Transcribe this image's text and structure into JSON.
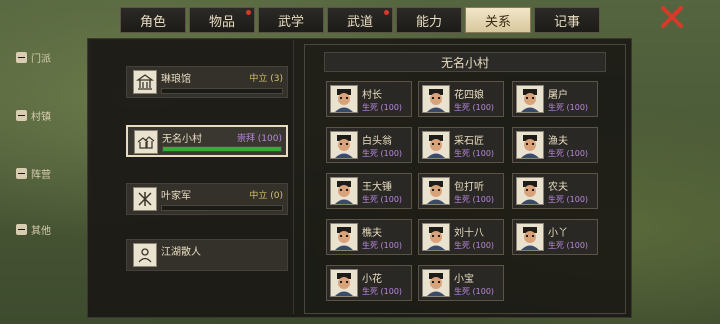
{
  "tabs": [
    {
      "label": "角色",
      "dot": false,
      "active": false
    },
    {
      "label": "物品",
      "dot": true,
      "active": false
    },
    {
      "label": "武学",
      "dot": false,
      "active": false
    },
    {
      "label": "武道",
      "dot": true,
      "active": false
    },
    {
      "label": "能力",
      "dot": false,
      "active": false
    },
    {
      "label": "关系",
      "dot": false,
      "active": true
    },
    {
      "label": "记事",
      "dot": false,
      "active": false
    }
  ],
  "colors": {
    "accent_active_tab": "#e6d9b4",
    "relation_neutral": "#d6c070",
    "relation_worship": "#b888e0",
    "bar_fill": "#3aaa3a",
    "close_x": "#d83a2a"
  },
  "sidebar": {
    "sections": [
      {
        "label": "门派",
        "items": [
          {
            "name": "琳琅馆",
            "relation": "中立 (3)",
            "progress": 0.0,
            "icon": "pavilion-icon"
          }
        ]
      },
      {
        "label": "村镇",
        "items": [
          {
            "name": "无名小村",
            "relation": "崇拜 (100)",
            "progress": 1.0,
            "icon": "village-icon",
            "selected": true
          }
        ]
      },
      {
        "label": "阵营",
        "items": [
          {
            "name": "叶家军",
            "relation": "中立 (0)",
            "progress": 0.0,
            "icon": "army-icon"
          }
        ]
      },
      {
        "label": "其他",
        "items": [
          {
            "name": "江湖散人",
            "relation": "",
            "progress": null,
            "icon": "wanderer-icon"
          }
        ]
      }
    ]
  },
  "main": {
    "title": "无名小村",
    "npcs": [
      {
        "name": "村长",
        "status": "生死 (100)"
      },
      {
        "name": "花四娘",
        "status": "生死 (100)"
      },
      {
        "name": "屠户",
        "status": "生死 (100)"
      },
      {
        "name": "白头翁",
        "status": "生死 (100)"
      },
      {
        "name": "采石匠",
        "status": "生死 (100)"
      },
      {
        "name": "渔夫",
        "status": "生死 (100)"
      },
      {
        "name": "王大锤",
        "status": "生死 (100)"
      },
      {
        "name": "包打听",
        "status": "生死 (100)"
      },
      {
        "name": "农夫",
        "status": "生死 (100)"
      },
      {
        "name": "樵夫",
        "status": "生死 (100)"
      },
      {
        "name": "刘十八",
        "status": "生死 (100)"
      },
      {
        "name": "小丫",
        "status": "生死 (100)"
      },
      {
        "name": "小花",
        "status": "生死 (100)"
      },
      {
        "name": "小宝",
        "status": "生死 (100)"
      }
    ]
  }
}
